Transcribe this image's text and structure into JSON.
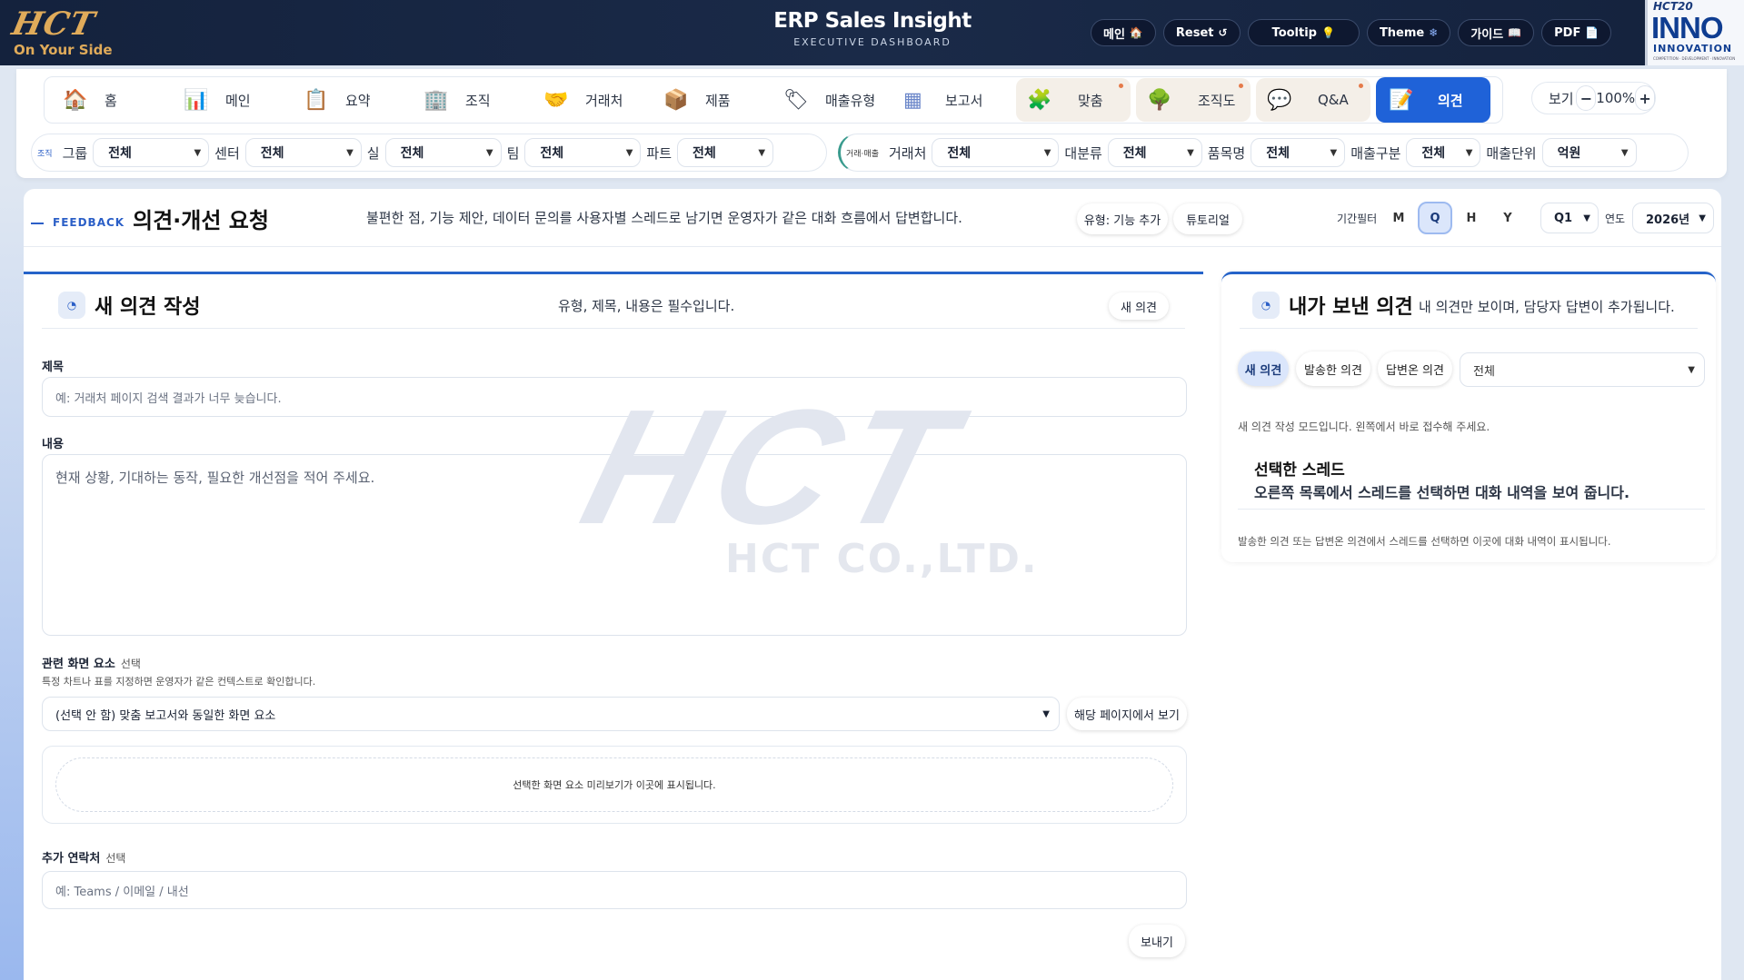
{
  "header": {
    "logo_word": "HCT",
    "logo_tagline": "On Your Side",
    "app_title": "ERP Sales Insight",
    "app_subtitle": "EXECUTIVE DASHBOARD",
    "buttons": [
      {
        "label": "메인",
        "icon": "🏠"
      },
      {
        "label": "Reset",
        "icon": "↺"
      },
      {
        "label": "Tooltip",
        "icon": "💡"
      },
      {
        "label": "Theme",
        "icon": "❄"
      },
      {
        "label": "가이드",
        "icon": "📖"
      },
      {
        "label": "PDF",
        "icon": "📄"
      }
    ],
    "inno": {
      "top": "HCT20",
      "main": "INNO",
      "sub": "INNOVATION",
      "fine": "COMPETITION · DEVELOPMENT · INNOVATION"
    }
  },
  "tabs": [
    {
      "label": "홈",
      "icon": "🏠"
    },
    {
      "label": "메인",
      "icon": "📊"
    },
    {
      "label": "요약",
      "icon": "📋"
    },
    {
      "label": "조직",
      "icon": "🏢"
    },
    {
      "label": "거래처",
      "icon": "🤝"
    },
    {
      "label": "제품",
      "icon": "📦"
    },
    {
      "label": "매출유형",
      "icon": "🏷"
    },
    {
      "label": "보고서",
      "icon": "▦"
    },
    {
      "label": "맞춤",
      "icon": "🧩"
    },
    {
      "label": "조직도",
      "icon": "🌳"
    },
    {
      "label": "Q&A",
      "icon": "💬"
    },
    {
      "label": "의견",
      "icon": "📝"
    }
  ],
  "zoom": {
    "label": "보기",
    "minus": "−",
    "value": "100%",
    "plus": "+"
  },
  "filters": {
    "org_badge": "조직",
    "org": [
      {
        "label": "그룹",
        "value": "전체"
      },
      {
        "label": "센터",
        "value": "전체"
      },
      {
        "label": "실",
        "value": "전체"
      },
      {
        "label": "팀",
        "value": "전체"
      },
      {
        "label": "파트",
        "value": "전체"
      }
    ],
    "trade_badge": "거래·매출",
    "trade": [
      {
        "label": "거래처",
        "value": "전체"
      },
      {
        "label": "대분류",
        "value": "전체"
      },
      {
        "label": "품목명",
        "value": "전체"
      },
      {
        "label": "매출구분",
        "value": "전체"
      },
      {
        "label": "매출단위",
        "value": "억원"
      }
    ]
  },
  "watermark": {
    "big": "HCT",
    "small": "HCT CO.,LTD."
  },
  "page": {
    "eyebrow": "FEEDBACK",
    "title": "의견·개선 요청",
    "desc": "불편한 점, 기능 제안, 데이터 문의를 사용자별 스레드로 남기면 운영자가 같은 대화 흐름에서 답변합니다.",
    "type_pill": "유형: 기능 추가",
    "tutorial": "튜토리얼",
    "period_label": "기간필터",
    "periods": [
      "M",
      "Q",
      "H",
      "Y"
    ],
    "quarter": "Q1",
    "year_label": "연도",
    "year": "2026년"
  },
  "form": {
    "title": "새 의견 작성",
    "required_note": "유형, 제목, 내용은 필수입니다.",
    "new_button": "새 의견",
    "subject_label": "제목",
    "subject_placeholder": "예: 거래처 페이지 검색 결과가 너무 늦습니다.",
    "body_label": "내용",
    "body_placeholder": "현재 상황, 기대하는 동작, 필요한 개선점을 적어 주세요.",
    "related_label": "관련 화면 요소",
    "optional": "선택",
    "related_hint": "특정 차트나 표를 지정하면 운영자가 같은 컨텍스트로 확인합니다.",
    "related_select": "(선택 안 함) 맞춤 보고서와 동일한 화면 요소",
    "view_button": "해당 페이지에서 보기",
    "preview_text": "선택한 화면 요소 미리보기가 이곳에 표시됩니다.",
    "contact_label": "추가 연락처",
    "contact_placeholder": "예: Teams / 이메일 / 내선",
    "send_button": "보내기"
  },
  "sent": {
    "title": "내가 보낸 의견",
    "subtitle": "내 의견만 보이며, 담당자 답변이 추가됩니다.",
    "tabs": [
      "새 의견",
      "발송한 의견",
      "답변온 의견"
    ],
    "filter": "전체",
    "mode_note": "새 의견 작성 모드입니다. 왼쪽에서 바로 접수해 주세요.",
    "thread_title": "선택한 스레드",
    "thread_desc": "오른쪽 목록에서 스레드를 선택하면 대화 내역을 보여 줍니다.",
    "thread_hint": "발송한 의견 또는 답변온 의견에서 스레드를 선택하면 이곳에 대화 내역이 표시됩니다."
  }
}
